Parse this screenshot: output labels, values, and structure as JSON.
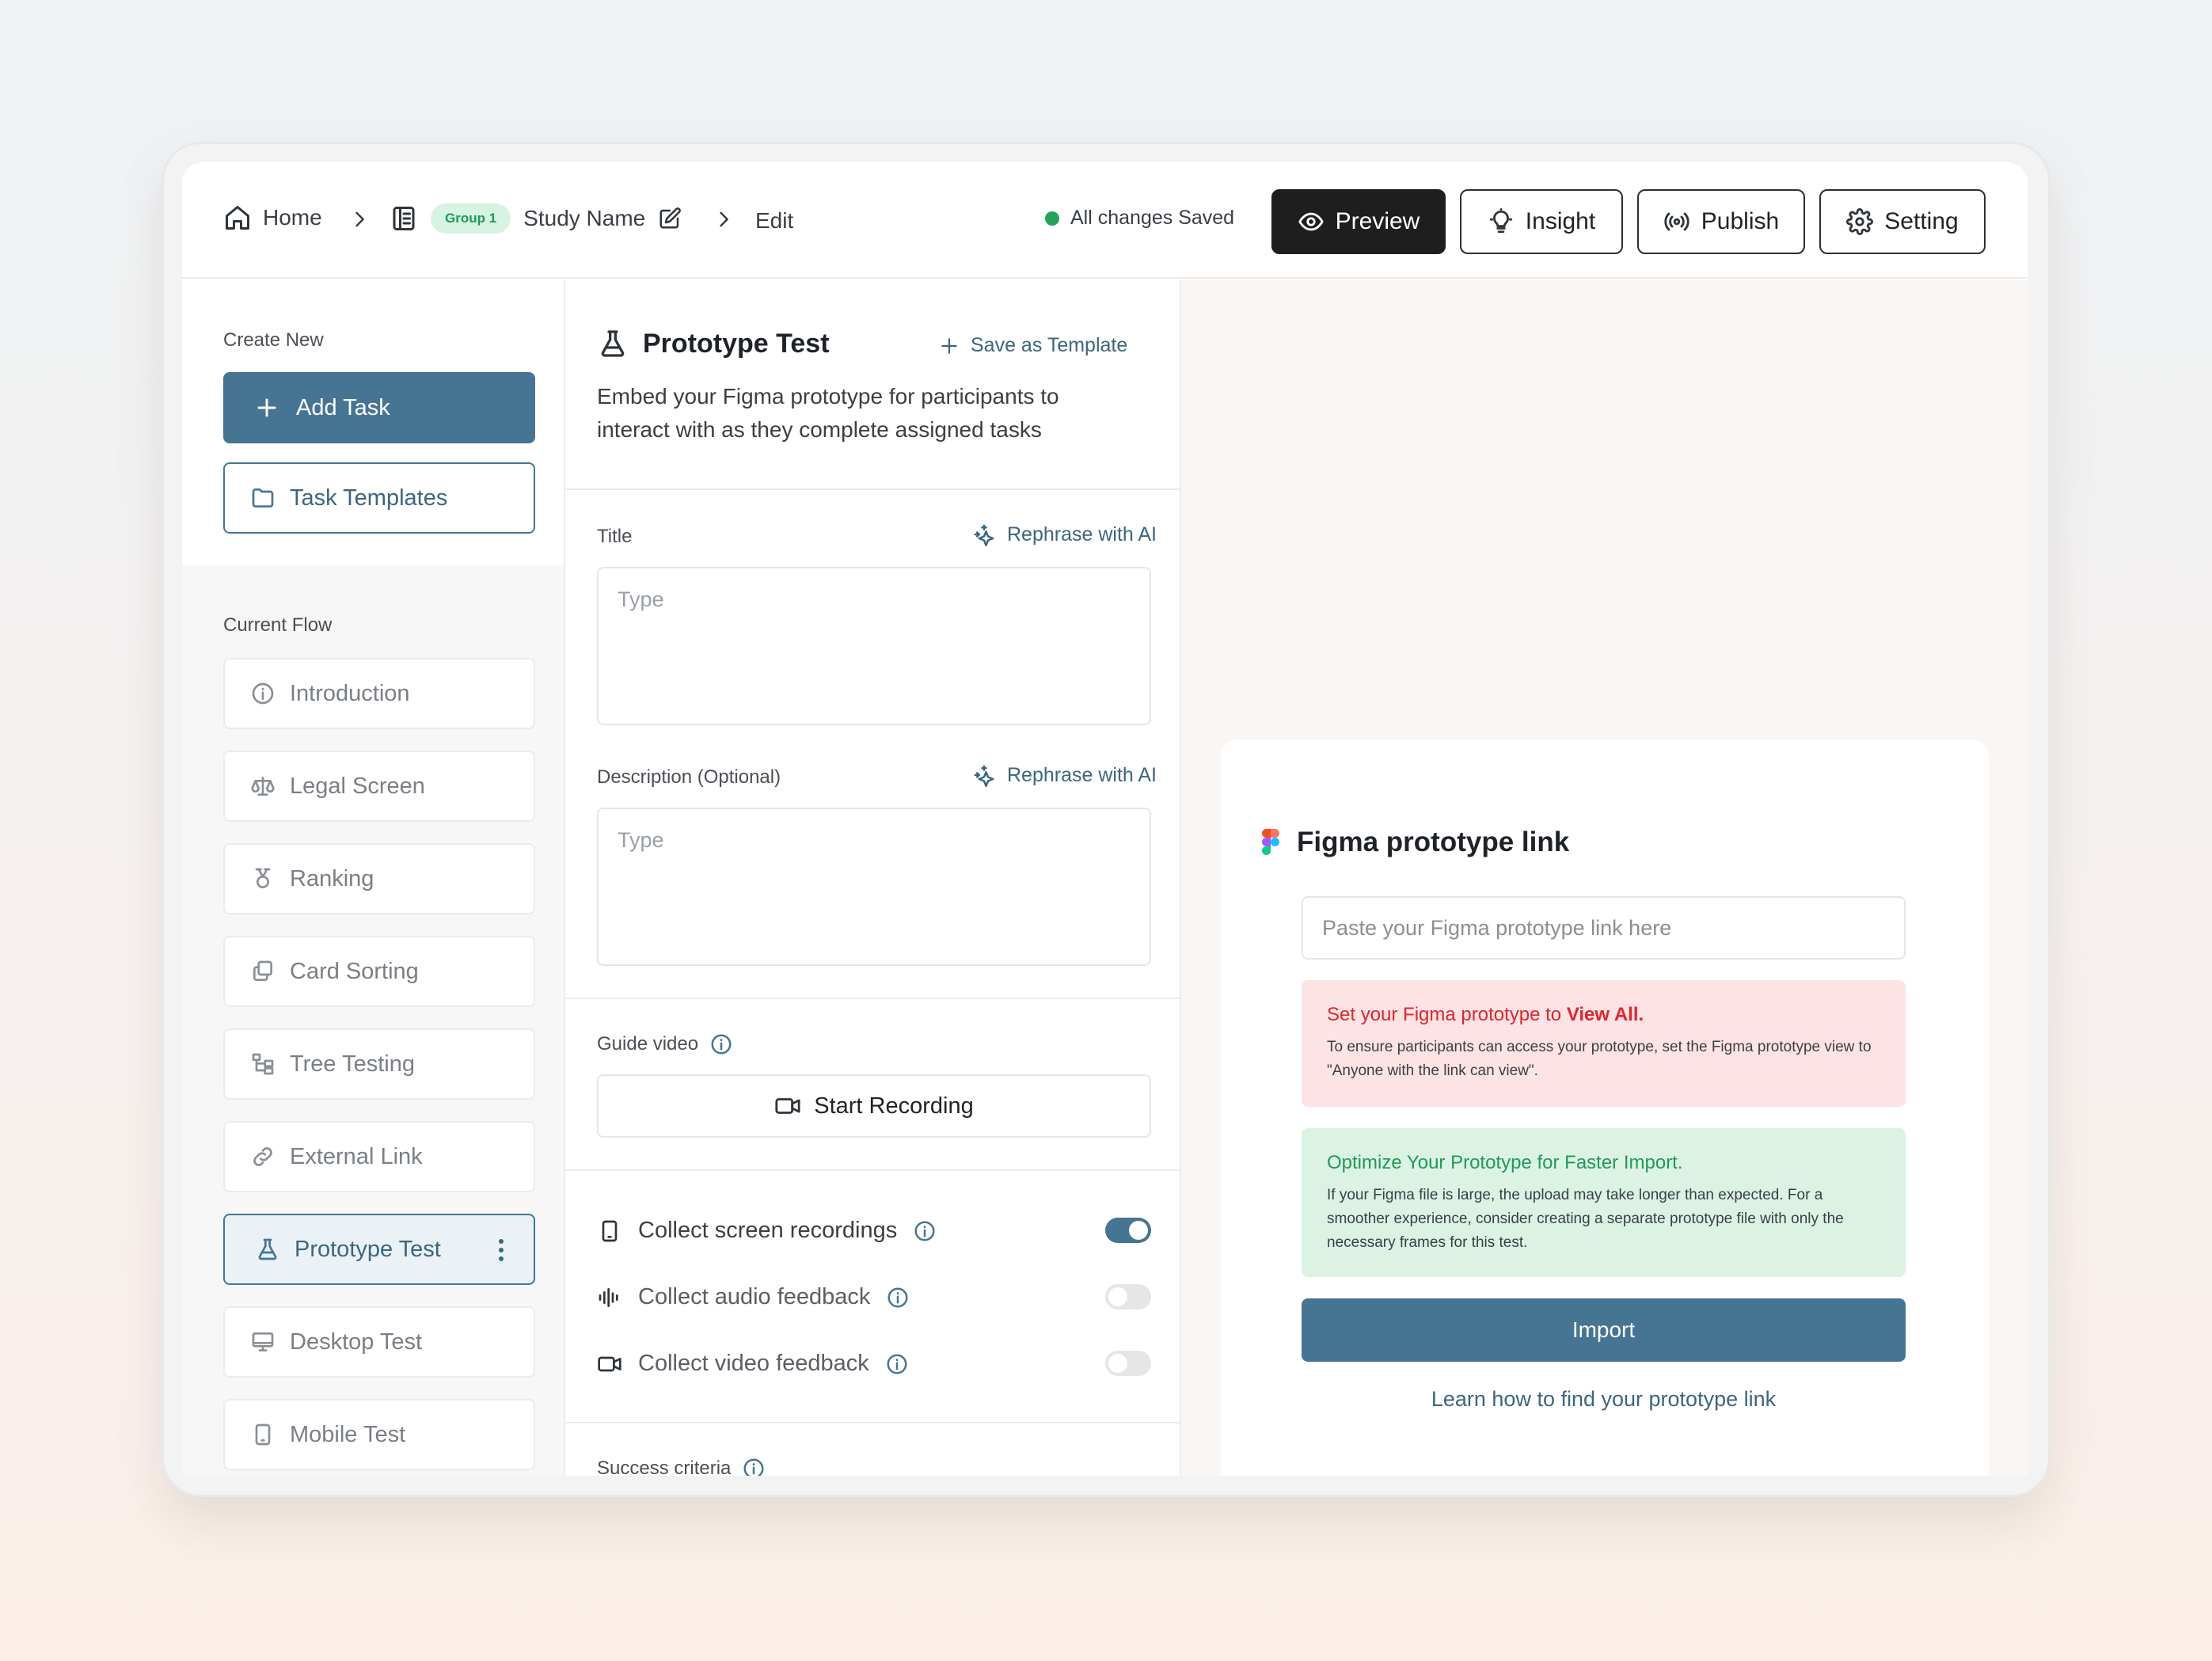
{
  "header": {
    "breadcrumb": {
      "home": "Home",
      "group_badge": "Group 1",
      "study_name": "Study Name",
      "edit": "Edit"
    },
    "status": "All changes Saved",
    "buttons": {
      "preview": "Preview",
      "insight": "Insight",
      "publish": "Publish",
      "setting": "Setting"
    }
  },
  "sidebar": {
    "create_new_label": "Create New",
    "add_task": "Add Task",
    "task_templates": "Task Templates",
    "current_flow_label": "Current Flow",
    "items": [
      {
        "label": "Introduction",
        "icon": "info-icon"
      },
      {
        "label": "Legal Screen",
        "icon": "scale-icon"
      },
      {
        "label": "Ranking",
        "icon": "medal-icon"
      },
      {
        "label": "Card Sorting",
        "icon": "cards-icon"
      },
      {
        "label": "Tree Testing",
        "icon": "tree-icon"
      },
      {
        "label": "External Link",
        "icon": "link-icon"
      },
      {
        "label": "Prototype Test",
        "icon": "flask-icon",
        "active": true
      },
      {
        "label": "Desktop Test",
        "icon": "monitor-icon"
      },
      {
        "label": "Mobile Test",
        "icon": "phone-icon"
      }
    ]
  },
  "editor": {
    "title": "Prototype Test",
    "save_template": "Save as Template",
    "description": "Embed your Figma prototype for participants to interact with as they complete assigned tasks",
    "title_label": "Title",
    "rephrase": "Rephrase with AI",
    "title_placeholder": "Type",
    "description_label": "Description (Optional)",
    "description_placeholder": "Type",
    "guide_video_label": "Guide video",
    "start_recording": "Start Recording",
    "toggles": [
      {
        "label": "Collect screen recordings",
        "on": true
      },
      {
        "label": "Collect audio feedback",
        "on": false
      },
      {
        "label": "Collect video feedback",
        "on": false
      }
    ],
    "success_criteria_label": "Success criteria"
  },
  "figma_card": {
    "title": "Figma prototype link",
    "input_placeholder": "Paste your Figma prototype link here",
    "warning": {
      "title_prefix": "Set your Figma prototype to ",
      "title_emphasis": "View All.",
      "body": "To ensure participants can access your prototype, set the Figma prototype view to \"Anyone with the link can view\"."
    },
    "tip": {
      "title": "Optimize Your Prototype for Faster Import.",
      "body": "If your Figma file is large, the upload may take longer than expected. For a smoother experience, consider creating a separate prototype file with only the necessary frames for this test."
    },
    "import_button": "Import",
    "learn_link": "Learn how to find your prototype link"
  },
  "colors": {
    "accent": "#467593",
    "saved_dot": "#22a35a",
    "warning_bg": "#fde3e3",
    "tip_bg": "#dcf3e4"
  }
}
